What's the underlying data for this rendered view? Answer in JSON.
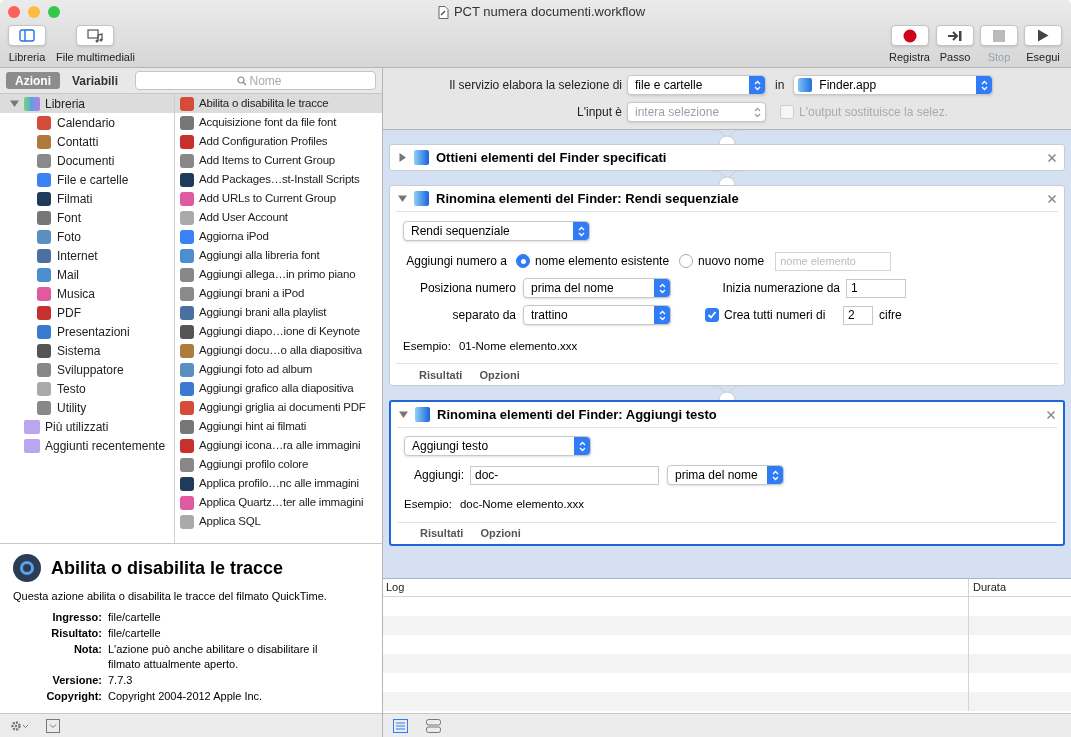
{
  "window": {
    "title": "PCT numera documenti.workflow"
  },
  "toolbar": {
    "left": [
      {
        "label": "Libreria",
        "kind": "library"
      },
      {
        "label": "File multimediali",
        "kind": "media"
      }
    ],
    "right": [
      {
        "label": "Registra",
        "kind": "record",
        "disabled": false
      },
      {
        "label": "Passo",
        "kind": "step",
        "disabled": false
      },
      {
        "label": "Stop",
        "kind": "stop",
        "disabled": true
      },
      {
        "label": "Esegui",
        "kind": "run",
        "disabled": false
      }
    ]
  },
  "sidebar": {
    "tabs": [
      {
        "label": "Azioni",
        "selected": true
      },
      {
        "label": "Variabili",
        "selected": false
      }
    ],
    "search": {
      "placeholder": "Nome"
    },
    "library": [
      {
        "label": "Libreria",
        "selected": true,
        "expanded": true,
        "children": [
          {
            "label": "Calendario"
          },
          {
            "label": "Contatti"
          },
          {
            "label": "Documenti"
          },
          {
            "label": "File e cartelle"
          },
          {
            "label": "Filmati"
          },
          {
            "label": "Font"
          },
          {
            "label": "Foto"
          },
          {
            "label": "Internet"
          },
          {
            "label": "Mail"
          },
          {
            "label": "Musica"
          },
          {
            "label": "PDF"
          },
          {
            "label": "Presentazioni"
          },
          {
            "label": "Sistema"
          },
          {
            "label": "Sviluppatore"
          },
          {
            "label": "Testo"
          },
          {
            "label": "Utility"
          }
        ]
      },
      {
        "label": "Più utilizzati",
        "selected": false
      },
      {
        "label": "Aggiunti recentemente",
        "selected": false
      }
    ],
    "actions": [
      {
        "label": "Abilita o disabilita le tracce",
        "selected": true
      },
      {
        "label": "Acquisizione font da file font",
        "selected": false
      },
      {
        "label": "Add Configuration Profiles",
        "selected": false
      },
      {
        "label": "Add Items to Current Group",
        "selected": false
      },
      {
        "label": "Add Packages…st-Install Scripts",
        "selected": false
      },
      {
        "label": "Add URLs to Current Group",
        "selected": false
      },
      {
        "label": "Add User Account",
        "selected": false
      },
      {
        "label": "Aggiorna iPod",
        "selected": false
      },
      {
        "label": "Aggiungi alla libreria font",
        "selected": false
      },
      {
        "label": "Aggiungi allega…in primo piano",
        "selected": false
      },
      {
        "label": "Aggiungi brani a iPod",
        "selected": false
      },
      {
        "label": "Aggiungi brani alla playlist",
        "selected": false
      },
      {
        "label": "Aggiungi diapo…ione di Keynote",
        "selected": false
      },
      {
        "label": "Aggiungi docu…o alla diapositiva",
        "selected": false
      },
      {
        "label": "Aggiungi foto ad album",
        "selected": false
      },
      {
        "label": "Aggiungi grafico alla diapositiva",
        "selected": false
      },
      {
        "label": "Aggiungi griglia ai documenti PDF",
        "selected": false
      },
      {
        "label": "Aggiungi hint ai filmati",
        "selected": false
      },
      {
        "label": "Aggiungi icona…ra alle immagini",
        "selected": false
      },
      {
        "label": "Aggiungi profilo colore",
        "selected": false
      },
      {
        "label": "Applica profilo…nc alle immagini",
        "selected": false
      },
      {
        "label": "Applica Quartz…ter alle immagini",
        "selected": false
      },
      {
        "label": "Applica SQL",
        "selected": false
      }
    ]
  },
  "description": {
    "title": "Abilita o disabilita le tracce",
    "text": "Questa azione abilita o disabilita le tracce del filmato QuickTime.",
    "fields": [
      {
        "label": "Ingresso:",
        "value": "file/cartelle"
      },
      {
        "label": "Risultato:",
        "value": "file/cartelle"
      },
      {
        "label": "Nota:",
        "value": "L'azione può anche abilitare o disabilitare il filmato attualmente aperto."
      },
      {
        "label": "Versione:",
        "value": "7.7.3"
      },
      {
        "label": "Copyright:",
        "value": "Copyright 2004-2012 Apple Inc."
      }
    ]
  },
  "service": {
    "label": "Il servizio elabora la selezione di",
    "selection": "file e cartelle",
    "in_label": "in",
    "app": "Finder.app",
    "input_label": "L'input è",
    "input": "intera selezione",
    "input_disabled": true,
    "output_label": "L'output sostituisce la selez.",
    "output_checked": false,
    "output_disabled": true
  },
  "workflow": [
    {
      "kind": "collapsed",
      "title": "Ottieni elementi del Finder specificati",
      "expanded": false,
      "selected": false
    },
    {
      "kind": "sequential",
      "title": "Rinomina elementi del Finder: Rendi sequenziale",
      "expanded": true,
      "selected": false,
      "mode": "Rendi sequenziale",
      "add_number_label": "Aggiungi numero a",
      "radios": [
        {
          "label": "nome elemento esistente",
          "selected": true
        },
        {
          "label": "nuovo nome",
          "selected": false
        }
      ],
      "new_name_placeholder": "nome elemento",
      "position_label": "Posiziona numero",
      "position": "prima del nome",
      "start_label": "Inizia numerazione da",
      "start": "1",
      "separator_label": "separato da",
      "separator": "trattino",
      "digits_label": "Crea tutti numeri di",
      "digits_checked": true,
      "digits": "2",
      "digits_suffix": "cifre",
      "example_label": "Esempio:",
      "example": "01-Nome elemento.xxx",
      "tabs": [
        "Risultati",
        "Opzioni"
      ]
    },
    {
      "kind": "add_text",
      "title": "Rinomina elementi del Finder: Aggiungi testo",
      "expanded": true,
      "selected": true,
      "mode": "Aggiungi testo",
      "add_label": "Aggiungi:",
      "add_value": "doc-",
      "position": "prima del nome",
      "example_label": "Esempio:",
      "example": "doc-Nome elemento.xxx",
      "tabs": [
        "Risultati",
        "Opzioni"
      ]
    }
  ],
  "log": {
    "columns": [
      "Log",
      "Durata"
    ]
  }
}
